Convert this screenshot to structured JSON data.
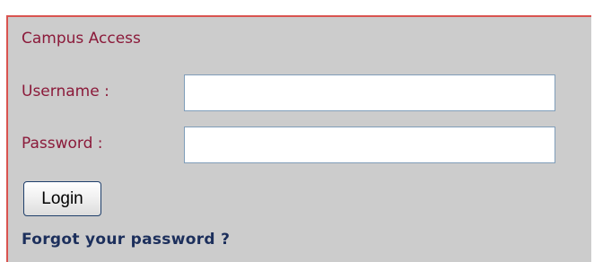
{
  "panel": {
    "title": "Campus Access",
    "border_color": "#d9534f",
    "background_color": "#cccccc"
  },
  "form": {
    "username_label": "Username :",
    "username_value": "",
    "password_label": "Password :",
    "password_value": "",
    "login_button": "Login",
    "forgot_link": "Forgot your password ?"
  },
  "colors": {
    "label_text": "#8b1a3a",
    "link_text": "#1c2f5c"
  }
}
